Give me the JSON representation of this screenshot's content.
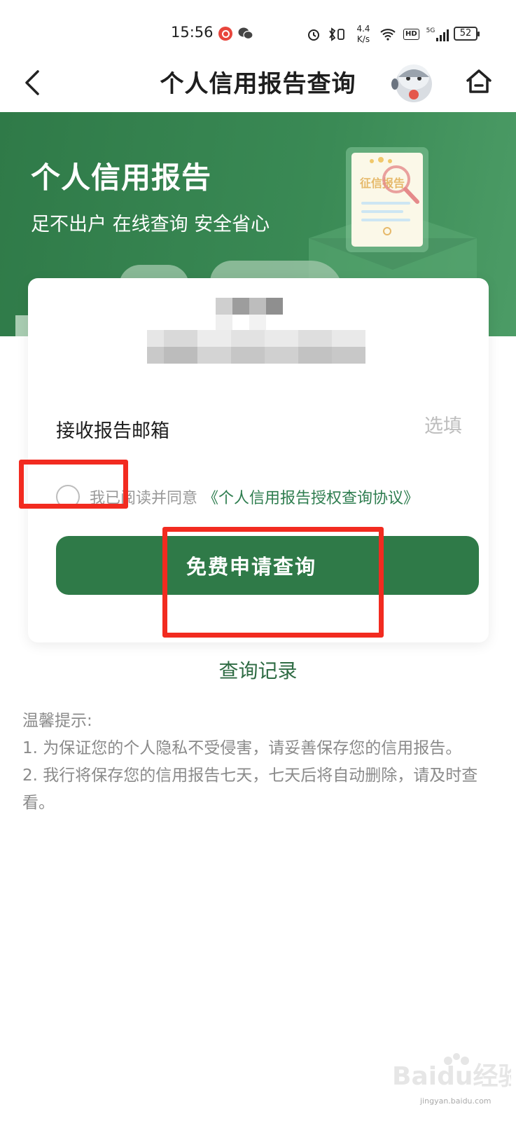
{
  "status_bar": {
    "time": "15:56",
    "net_speed_value": "4.4",
    "net_speed_unit": "K/s",
    "hd": "HD",
    "signal": "5G",
    "battery": "52"
  },
  "nav": {
    "title": "个人信用报告查询"
  },
  "hero": {
    "title": "个人信用报告",
    "subtitle": "足不出户 在线查询 安全省心",
    "badge_text": "征信报告"
  },
  "form": {
    "email_label": "接收报告邮箱",
    "email_placeholder": "选填",
    "agree_text": "我已阅读并同意",
    "agree_link": "《个人信用报告授权查询协议》",
    "submit_label": "免费申请查询"
  },
  "history_link": "查询记录",
  "tips": {
    "heading": "温馨提示:",
    "line1": "1. 为保证您的个人隐私不受侵害，请妥善保存您的信用报告。",
    "line2": "2. 我行将保存您的信用报告七天，七天后将自动删除，请及时查看。"
  },
  "watermark": {
    "brand": "Baidu经验",
    "site": "jingyan.baidu.com"
  },
  "colors": {
    "brand_green": "#2f7a48",
    "link_green": "#2e7d4f",
    "annotation_red": "#f22b20"
  }
}
